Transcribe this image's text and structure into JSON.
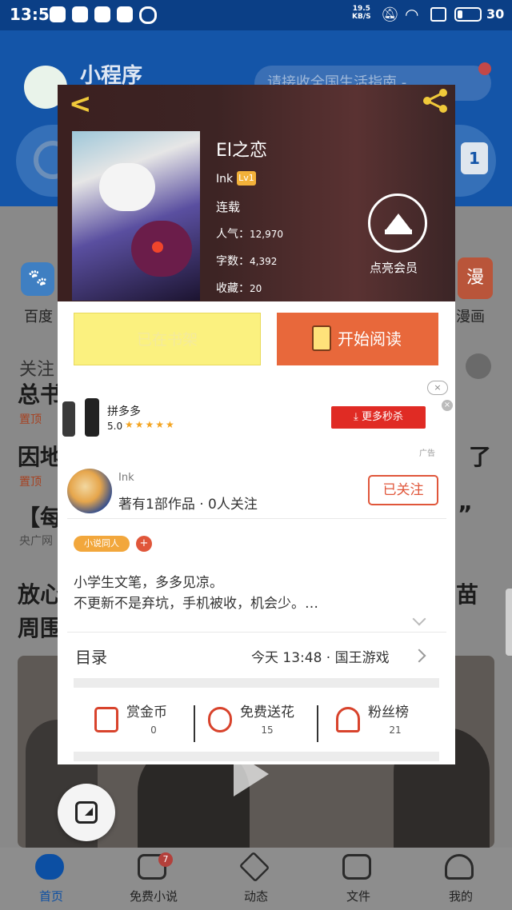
{
  "status_bar": {
    "time": "13:54",
    "speed_value": "19.5",
    "speed_unit": "KB/S",
    "battery": "30"
  },
  "background_app": {
    "title": "小程序",
    "marquee": "请接收全国生活指南 -",
    "search_badge": "1",
    "grid": [
      {
        "label": "百度"
      },
      {
        "label": "漫画",
        "icon_text": "漫"
      }
    ],
    "follow_label": "关注",
    "news": [
      {
        "title": "总书",
        "tag": "置顶"
      },
      {
        "title": "因地",
        "tag": "置顶",
        "right_fragment": "了"
      },
      {
        "title": "【每",
        "source": "央广网",
        "right_fragment": "”"
      },
      {
        "title": "放心",
        "right_fragment": "苗"
      },
      {
        "title": "周围"
      }
    ]
  },
  "tabbar": {
    "items": [
      {
        "label": "首页",
        "active": true
      },
      {
        "label": "免费小说",
        "badge": "7"
      },
      {
        "label": "动态"
      },
      {
        "label": "文件"
      },
      {
        "label": "我的"
      }
    ]
  },
  "book": {
    "title": "El之恋",
    "author": "Ink",
    "level": "Lv1",
    "status": "连载",
    "stats": [
      {
        "label": "人气：",
        "value": "12,970"
      },
      {
        "label": "字数：",
        "value": "4,392"
      },
      {
        "label": "收藏：",
        "value": "20"
      }
    ],
    "vip_label": "点亮会员"
  },
  "actions": {
    "shelf": "已在书架",
    "read": "开始阅读"
  },
  "ad": {
    "brand": "拼多多",
    "rating": "5.0",
    "stars": "★★★★★",
    "cta": "更多秒杀",
    "label": "广告",
    "close": "×"
  },
  "author": {
    "name": "Ink",
    "info": "著有1部作品 · 0人关注",
    "follow_btn": "已关注"
  },
  "tags": {
    "fan": "小说同人",
    "plus": "+"
  },
  "description": {
    "line1": "小学生文笔，多多见凉。",
    "line2": "不更新不是弃坑，手机被收，机会少。…"
  },
  "toc": {
    "label": "目录",
    "latest": "今天 13:48 · 国王游戏"
  },
  "gifts": [
    {
      "label": "赏金币",
      "count": "0"
    },
    {
      "label": "免费送花",
      "count": "15"
    },
    {
      "label": "粉丝榜",
      "count": "21"
    }
  ],
  "colors": {
    "accent_orange": "#e8683b",
    "shelf_yellow": "#fbf17f",
    "brand_blue": "#1455a8"
  }
}
